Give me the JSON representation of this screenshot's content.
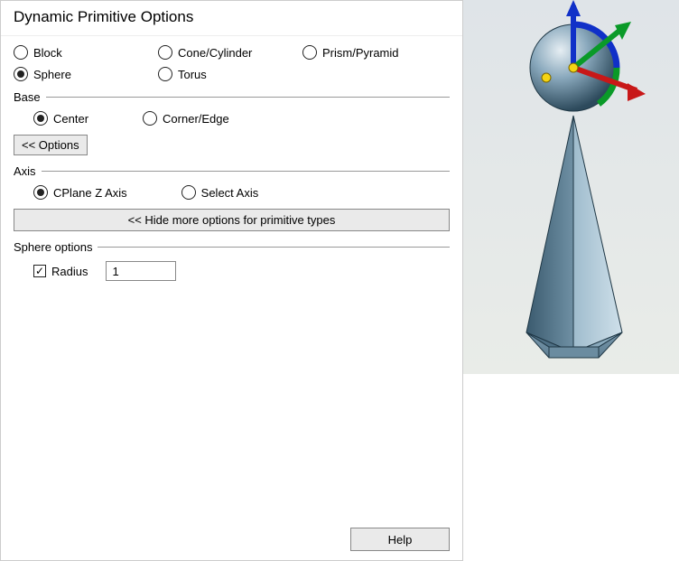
{
  "title": "Dynamic Primitive Options",
  "primitives": {
    "block": "Block",
    "cone": "Cone/Cylinder",
    "prism": "Prism/Pyramid",
    "sphere": "Sphere",
    "torus": "Torus",
    "selected": "sphere"
  },
  "base": {
    "legend": "Base",
    "center": "Center",
    "corner": "Corner/Edge",
    "selected": "center"
  },
  "options_btn": "<< Options",
  "axis": {
    "legend": "Axis",
    "cplane": "CPlane Z Axis",
    "select": "Select Axis",
    "selected": "cplane"
  },
  "more_btn": "<< Hide more options for primitive types",
  "sphere": {
    "legend": "Sphere options",
    "radius_label": "Radius",
    "radius_checked": true,
    "radius_value": "1"
  },
  "help_btn": "Help"
}
